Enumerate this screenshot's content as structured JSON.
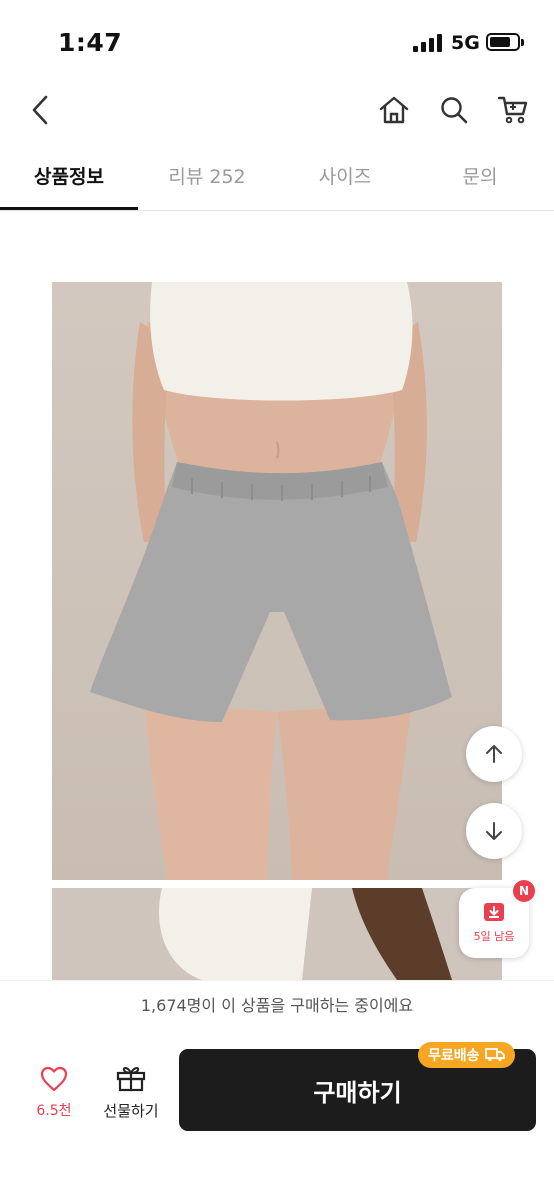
{
  "status_bar": {
    "time": "1:47",
    "network": "5G"
  },
  "tabs": [
    {
      "label": "상품정보"
    },
    {
      "label": "리뷰 252"
    },
    {
      "label": "사이즈"
    },
    {
      "label": "문의"
    }
  ],
  "coupon": {
    "label": "5일 남음",
    "badge": "N"
  },
  "notice": {
    "text": "1,674명이 이 상품을 구매하는 중이에요"
  },
  "bottom_bar": {
    "like_count": "6.5천",
    "gift_label": "선물하기",
    "buy_label": "구매하기",
    "free_shipping_label": "무료배송"
  },
  "colors": {
    "accent_red": "#ea3f4f",
    "buy_button": "#1c1c1c",
    "shipping_badge": "#f6a623"
  },
  "icons": [
    "back-icon",
    "home-icon",
    "search-icon",
    "cart-icon",
    "arrow-up-icon",
    "arrow-down-icon",
    "coupon-icon",
    "heart-icon",
    "gift-icon",
    "truck-icon"
  ]
}
